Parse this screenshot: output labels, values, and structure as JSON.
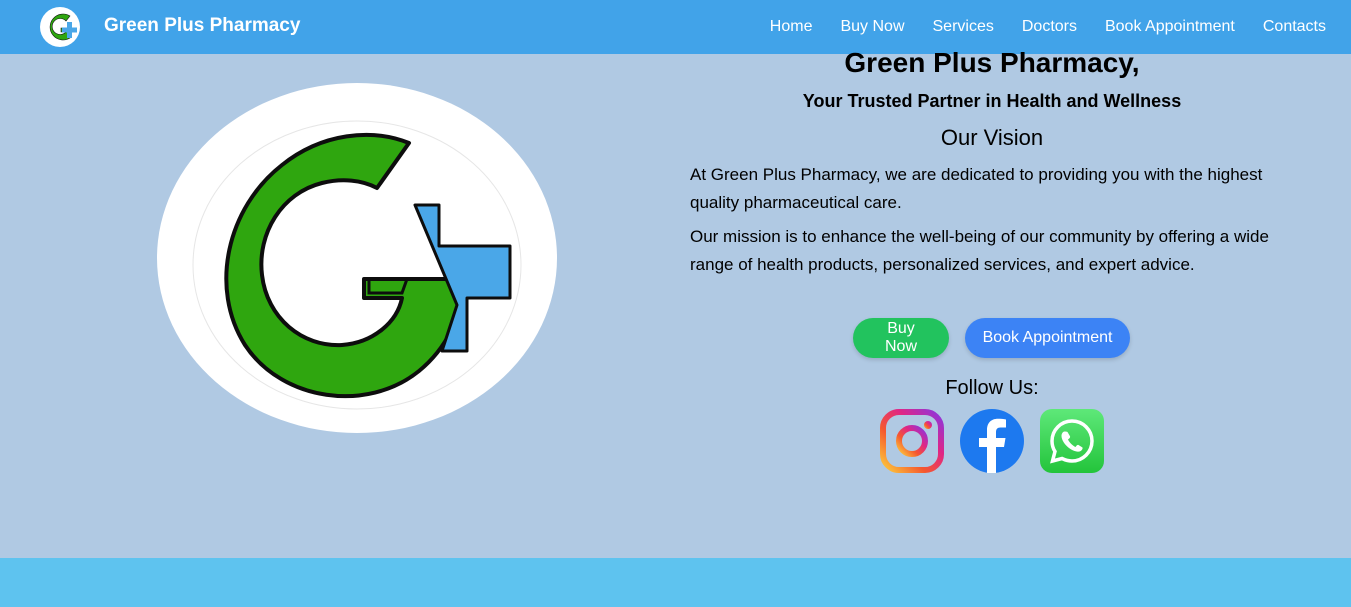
{
  "navbar": {
    "brand": "Green Plus Pharmacy",
    "links": [
      "Home",
      "Buy Now",
      "Services",
      "Doctors",
      "Book Appointment",
      "Contacts"
    ]
  },
  "hero": {
    "title": "Green Plus Pharmacy,",
    "subtitle": "Your Trusted Partner in Health and Wellness",
    "vision_heading": "Our Vision",
    "paragraph1": "At Green Plus Pharmacy, we are dedicated to providing you with the highest quality pharmaceutical care.",
    "paragraph2": "Our mission is to enhance the well-being of our community by offering a wide range of health products, personalized services, and expert advice.",
    "buy_label": "Buy Now",
    "book_label": "Book Appointment",
    "follow_label": "Follow Us:"
  },
  "socials": [
    "instagram-icon",
    "facebook-icon",
    "whatsapp-icon"
  ],
  "colors": {
    "navbar": "#41a3e9",
    "background": "#b0c9e3",
    "footer": "#5ec3ef",
    "buy_button": "#22c35e",
    "book_button": "#3c83f5",
    "logo_green": "#2fa60f",
    "logo_blue": "#4aa7e8"
  }
}
